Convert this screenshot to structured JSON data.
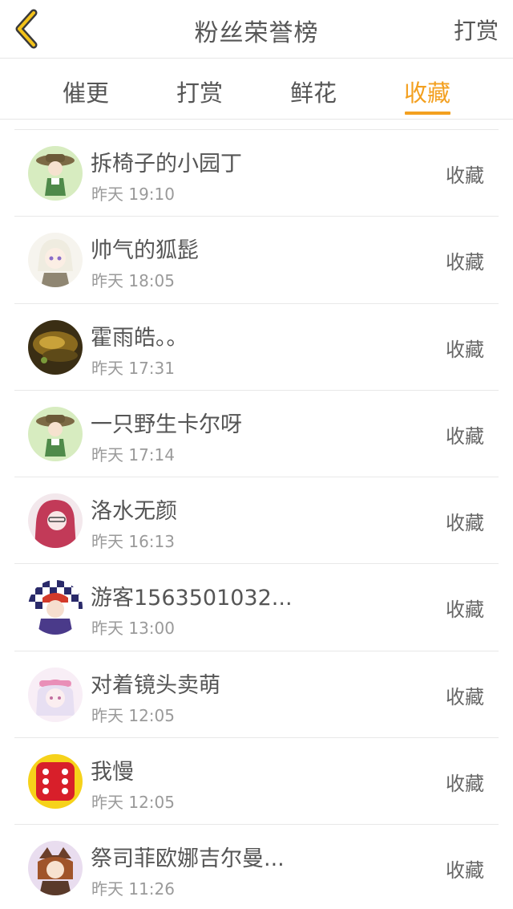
{
  "header": {
    "back_icon": "chevron-left-icon",
    "title": "粉丝荣誉榜",
    "action_label": "打赏",
    "accent_color": "#f3a020"
  },
  "tabs": [
    {
      "label": "催更",
      "active": false
    },
    {
      "label": "打赏",
      "active": false
    },
    {
      "label": "鲜花",
      "active": false
    },
    {
      "label": "收藏",
      "active": true
    }
  ],
  "fans": [
    {
      "name": "拆椅子的小园丁",
      "time": "昨天 19:10",
      "action": "收藏"
    },
    {
      "name": "帅气的狐髭",
      "time": "昨天 18:05",
      "action": "收藏"
    },
    {
      "name": "霍雨皓。。",
      "time": "昨天 17:31",
      "action": "收藏"
    },
    {
      "name": "一只野生卡尔呀",
      "time": "昨天 17:14",
      "action": "收藏"
    },
    {
      "name": "洛水无颜",
      "time": "昨天 16:13",
      "action": "收藏"
    },
    {
      "name": "游客1563501032...",
      "time": "昨天 13:00",
      "action": "收藏"
    },
    {
      "name": "对着镜头卖萌",
      "time": "昨天 12:05",
      "action": "收藏"
    },
    {
      "name": "我慢",
      "time": "昨天 12:05",
      "action": "收藏"
    },
    {
      "name": "祭司菲欧娜吉尔曼...",
      "time": "昨天 11:26",
      "action": "收藏"
    }
  ]
}
